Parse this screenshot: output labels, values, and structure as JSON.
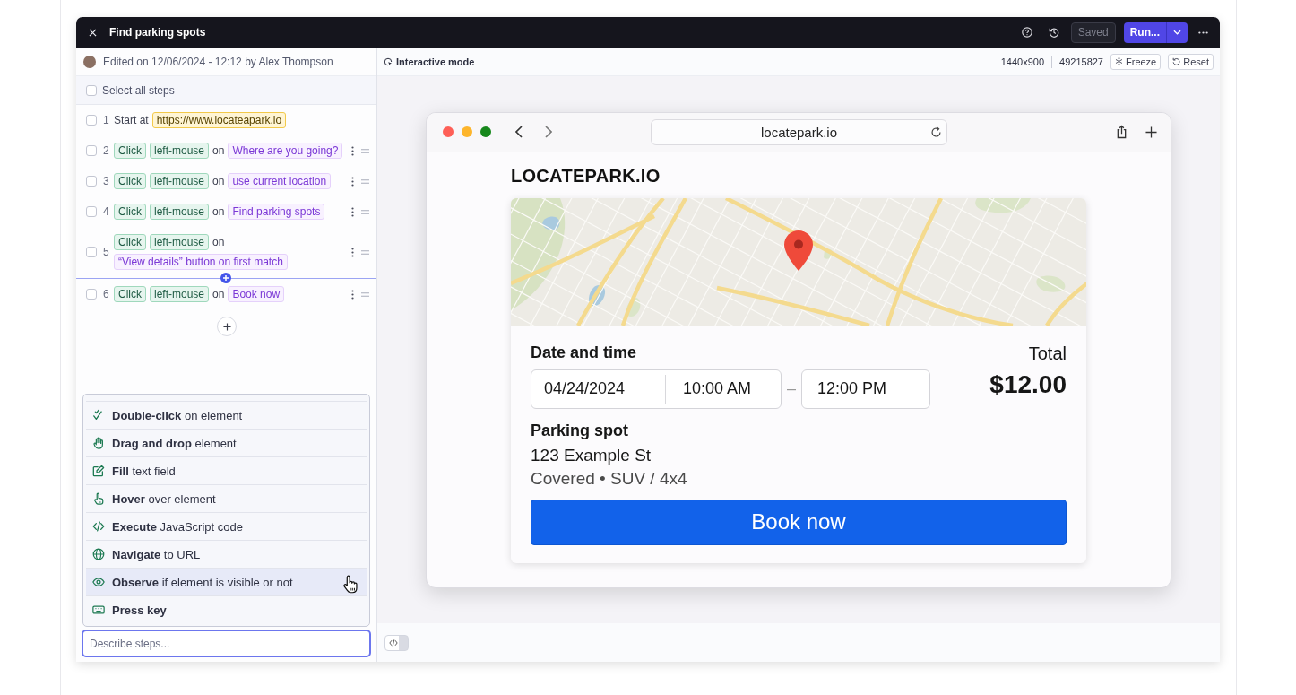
{
  "window": {
    "title": "Find parking spots"
  },
  "header_actions": {
    "save_button": {
      "label": "Saved",
      "disabled": true
    },
    "run_button": {
      "label": "Run..."
    }
  },
  "editor": {
    "edit_info": "Edited on 12/06/2024 - 12:12 by Alex Thompson",
    "select_all": {
      "label": "Select all steps",
      "checked": false
    },
    "steps": [
      {
        "number": "1",
        "kind": "start",
        "checked": false,
        "label": "Start at",
        "target": "https://www.locateapark.io"
      },
      {
        "number": "2",
        "kind": "click",
        "checked": false,
        "action": "Click",
        "button": "left-mouse",
        "connector": "on",
        "target": "Where are you going?"
      },
      {
        "number": "3",
        "kind": "click",
        "checked": false,
        "action": "Click",
        "button": "left-mouse",
        "connector": "on",
        "target": "use current location"
      },
      {
        "number": "4",
        "kind": "click",
        "checked": false,
        "action": "Click",
        "button": "left-mouse",
        "connector": "on",
        "target": "Find parking spots"
      },
      {
        "number": "5",
        "kind": "click",
        "checked": false,
        "action": "Click",
        "button": "left-mouse",
        "connector": "on",
        "target": "“View details” button on first match"
      },
      {
        "kind": "insert-line"
      },
      {
        "number": "6",
        "kind": "click",
        "checked": false,
        "action": "Click",
        "button": "left-mouse",
        "connector": "on",
        "target": "Book now"
      }
    ],
    "action_menu": [
      {
        "kind": "double-click",
        "action": "Double-click",
        "detail": "on element",
        "selected": false
      },
      {
        "kind": "drag",
        "action": "Drag and drop",
        "detail": "element",
        "selected": false
      },
      {
        "kind": "fill",
        "action": "Fill",
        "detail": "text field",
        "selected": false
      },
      {
        "kind": "hover",
        "action": "Hover",
        "detail": "over element",
        "selected": false
      },
      {
        "kind": "execute",
        "action": "Execute",
        "detail": "JavaScript code",
        "selected": false
      },
      {
        "kind": "navigate",
        "action": "Navigate",
        "detail": "to URL",
        "selected": false
      },
      {
        "kind": "observe",
        "action": "Observe",
        "detail": "if element is visible or not",
        "selected": true
      },
      {
        "kind": "press-key",
        "action": "Press key",
        "selected": false
      }
    ],
    "prompt": {
      "placeholder": "Describe steps..."
    }
  },
  "preview": {
    "mode": "Interactive mode",
    "resolution": "1440x900",
    "number": "49215827",
    "freeze_button": "Freeze",
    "reset_button": "Reset",
    "browser": {
      "url": "locatepark.io",
      "page": {
        "logo": "LOCATEPARK.IO",
        "date_label": "Date and time",
        "date": "04/24/2024",
        "start_time": "10:00 AM",
        "separator": "–",
        "end_time": "12:00 PM",
        "total_label": "Total",
        "total": "$12.00",
        "spot_label": "Parking spot",
        "address": "123 Example St",
        "details": "Covered • SUV / 4x4",
        "book_button": "Book now"
      }
    },
    "code_toggle": {
      "on": false
    }
  }
}
